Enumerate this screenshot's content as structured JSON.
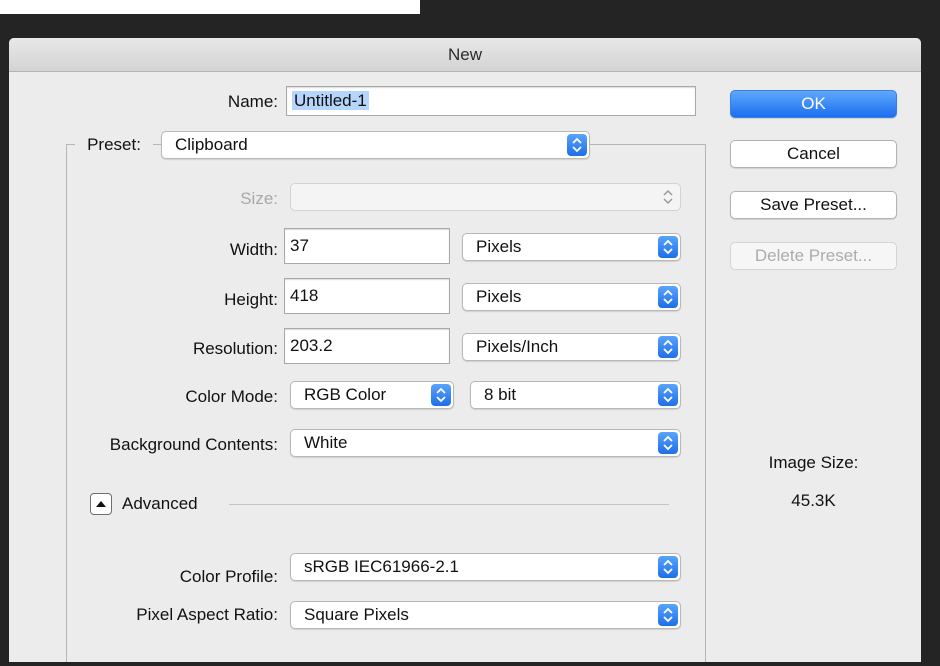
{
  "dialog": {
    "title": "New"
  },
  "name": {
    "label": "Name:",
    "value": "Untitled-1"
  },
  "preset": {
    "label": "Preset:",
    "value": "Clipboard"
  },
  "size": {
    "label": "Size:",
    "value": ""
  },
  "width": {
    "label": "Width:",
    "value": "37",
    "unit": "Pixels"
  },
  "height": {
    "label": "Height:",
    "value": "418",
    "unit": "Pixels"
  },
  "resolution": {
    "label": "Resolution:",
    "value": "203.2",
    "unit": "Pixels/Inch"
  },
  "color_mode": {
    "label": "Color Mode:",
    "value": "RGB Color",
    "depth": "8 bit"
  },
  "background_contents": {
    "label": "Background Contents:",
    "value": "White"
  },
  "advanced": {
    "label": "Advanced"
  },
  "color_profile": {
    "label": "Color Profile:",
    "value": "sRGB IEC61966-2.1"
  },
  "pixel_aspect_ratio": {
    "label": "Pixel Aspect Ratio:",
    "value": "Square Pixels"
  },
  "buttons": {
    "ok": "OK",
    "cancel": "Cancel",
    "save_preset": "Save Preset...",
    "delete_preset": "Delete Preset..."
  },
  "image_size": {
    "label": "Image Size:",
    "value": "45.3K"
  },
  "colors": {
    "accent": "#1e6fe8",
    "dialog_bg": "#ececec",
    "window_bg": "#242424"
  },
  "icons": {
    "popup_arrows": "updown-chevron-icon",
    "disclosure": "triangle-up-icon"
  }
}
